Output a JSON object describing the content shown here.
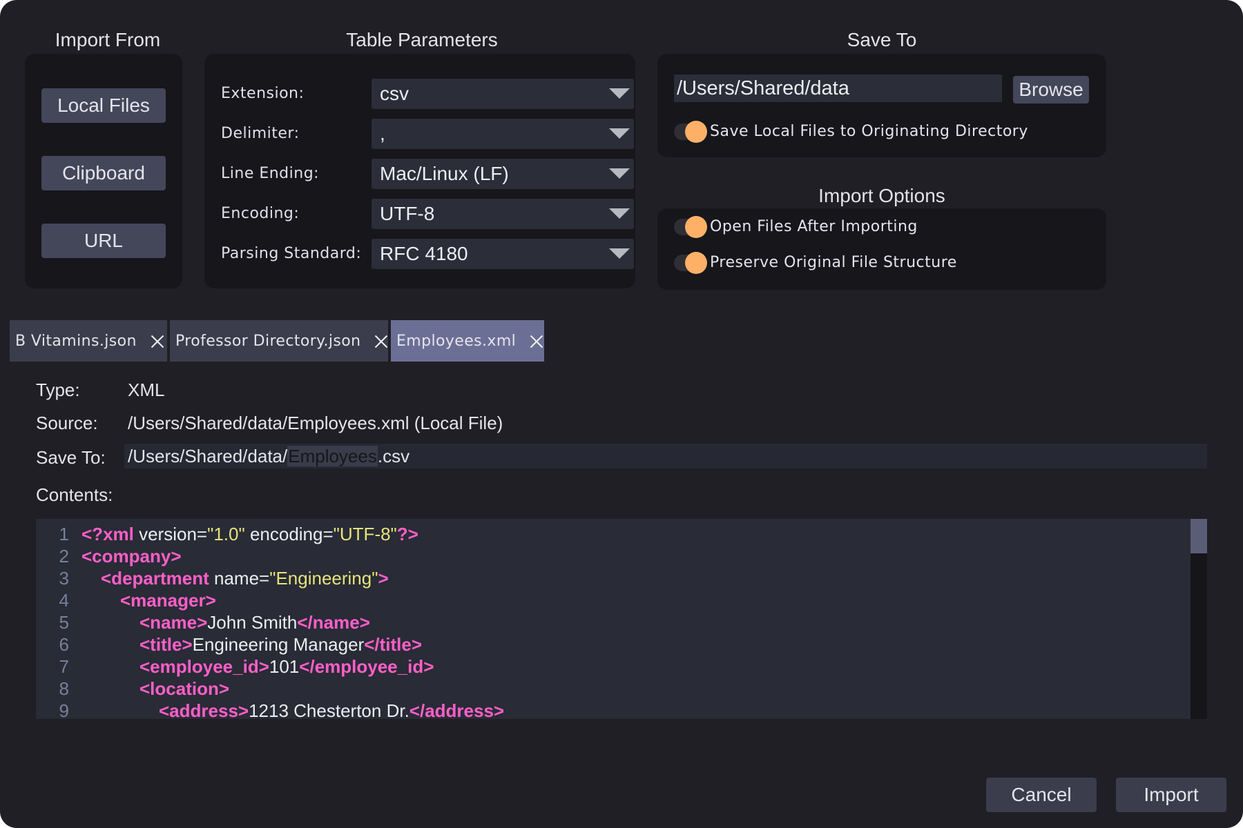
{
  "import_from": {
    "title": "Import From",
    "buttons": [
      "Local Files",
      "Clipboard",
      "URL"
    ]
  },
  "table_parameters": {
    "title": "Table Parameters",
    "rows": [
      {
        "label": "Extension:",
        "value": "csv"
      },
      {
        "label": "Delimiter:",
        "value": ","
      },
      {
        "label": "Line Ending:",
        "value": "Mac/Linux (LF)"
      },
      {
        "label": "Encoding:",
        "value": "UTF-8"
      },
      {
        "label": "Parsing Standard:",
        "value": "RFC 4180"
      }
    ]
  },
  "save_to": {
    "title": "Save To",
    "path": "/Users/Shared/data",
    "browse_label": "Browse",
    "toggle_label": "Save Local Files to Originating Directory",
    "toggle_on": true
  },
  "import_options": {
    "title": "Import Options",
    "toggles": [
      {
        "label": "Open Files After Importing",
        "on": true
      },
      {
        "label": "Preserve Original File Structure",
        "on": true
      }
    ]
  },
  "tabs": [
    {
      "label": "B Vitamins.json",
      "active": false
    },
    {
      "label": "Professor Directory.json",
      "active": false
    },
    {
      "label": "Employees.xml",
      "active": true
    }
  ],
  "file_info": {
    "type_label": "Type:",
    "type_value": "XML",
    "source_label": "Source:",
    "source_value": "/Users/Shared/data/Employees.xml (Local File)",
    "save_label": "Save To:",
    "save_prefix": "/Users/Shared/data/",
    "save_name": "Employees",
    "save_suffix": ".csv",
    "contents_label": "Contents:"
  },
  "code_lines": [
    {
      "n": "1",
      "indent": 0,
      "parts": [
        [
          "tag",
          "<?xml"
        ],
        [
          "attr",
          " version="
        ],
        [
          "str",
          "\"1.0\""
        ],
        [
          "attr",
          " encoding="
        ],
        [
          "str",
          "\"UTF-8\""
        ],
        [
          "tag",
          "?>"
        ]
      ]
    },
    {
      "n": "2",
      "indent": 0,
      "parts": [
        [
          "tag",
          "<company>"
        ]
      ]
    },
    {
      "n": "3",
      "indent": 1,
      "parts": [
        [
          "tag",
          "<department"
        ],
        [
          "attr",
          " name="
        ],
        [
          "str",
          "\"Engineering\""
        ],
        [
          "tag",
          ">"
        ]
      ]
    },
    {
      "n": "4",
      "indent": 2,
      "parts": [
        [
          "tag",
          "<manager>"
        ]
      ]
    },
    {
      "n": "5",
      "indent": 3,
      "parts": [
        [
          "tag",
          "<name>"
        ],
        [
          "txt",
          "John Smith"
        ],
        [
          "tag",
          "</name>"
        ]
      ]
    },
    {
      "n": "6",
      "indent": 3,
      "parts": [
        [
          "tag",
          "<title>"
        ],
        [
          "txt",
          "Engineering Manager"
        ],
        [
          "tag",
          "</title>"
        ]
      ]
    },
    {
      "n": "7",
      "indent": 3,
      "parts": [
        [
          "tag",
          "<employee_id>"
        ],
        [
          "txt",
          "101"
        ],
        [
          "tag",
          "</employee_id>"
        ]
      ]
    },
    {
      "n": "8",
      "indent": 3,
      "parts": [
        [
          "tag",
          "<location>"
        ]
      ]
    },
    {
      "n": "9",
      "indent": 4,
      "parts": [
        [
          "tag",
          "<address>"
        ],
        [
          "txt",
          "1213 Chesterton Dr."
        ],
        [
          "tag",
          "</address>"
        ]
      ]
    }
  ],
  "footer": {
    "cancel_label": "Cancel",
    "import_label": "Import"
  },
  "colors": {
    "accent_toggle": "#ffb067",
    "xml_tag": "#ff5fc8",
    "xml_string": "#e6e37a",
    "active_tab": "#6c6f95"
  }
}
